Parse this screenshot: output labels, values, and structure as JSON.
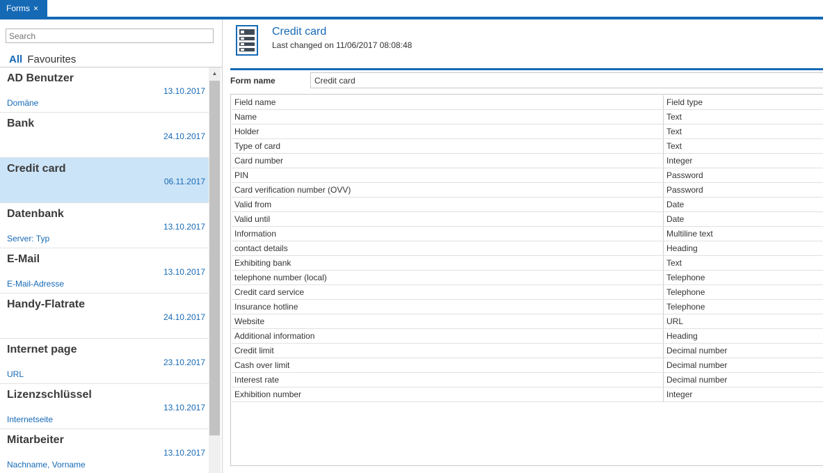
{
  "tab": {
    "label": "Forms",
    "close": "×"
  },
  "search": {
    "placeholder": "Search"
  },
  "filters": {
    "all": "All",
    "favourites": "Favourites"
  },
  "list": [
    {
      "title": "AD Benutzer",
      "date": "13.10.2017",
      "sub": "Domäne",
      "selected": false
    },
    {
      "title": "Bank",
      "date": "24.10.2017",
      "sub": "",
      "selected": false
    },
    {
      "title": "Credit card",
      "date": "06.11.2017",
      "sub": "",
      "selected": true
    },
    {
      "title": "Datenbank",
      "date": "13.10.2017",
      "sub": "Server: Typ",
      "selected": false
    },
    {
      "title": "E-Mail",
      "date": "13.10.2017",
      "sub": "E-Mail-Adresse",
      "selected": false
    },
    {
      "title": "Handy-Flatrate",
      "date": "24.10.2017",
      "sub": "",
      "selected": false
    },
    {
      "title": "Internet page",
      "date": "23.10.2017",
      "sub": "URL",
      "selected": false
    },
    {
      "title": "Lizenzschlüssel",
      "date": "13.10.2017",
      "sub": "Internetseite",
      "selected": false
    },
    {
      "title": "Mitarbeiter",
      "date": "13.10.2017",
      "sub": "Nachname, Vorname",
      "selected": false
    }
  ],
  "scrollbar": {
    "up_arrow": "▲"
  },
  "detail": {
    "title": "Credit card",
    "last_changed": "Last changed on 11/06/2017 08:08:48",
    "form_name_label": "Form name",
    "form_name_value": "Credit card",
    "columns": [
      "Field name",
      "Field type"
    ],
    "rows": [
      [
        "Name",
        "Text"
      ],
      [
        "Holder",
        "Text"
      ],
      [
        "Type of card",
        "Text"
      ],
      [
        "Card number",
        "Integer"
      ],
      [
        "PIN",
        "Password"
      ],
      [
        "Card verification number (OVV)",
        "Password"
      ],
      [
        "Valid from",
        "Date"
      ],
      [
        "Valid until",
        "Date"
      ],
      [
        "Information",
        "Multiline text"
      ],
      [
        "contact details",
        "Heading"
      ],
      [
        "Exhibiting bank",
        "Text"
      ],
      [
        "telephone number (local)",
        "Telephone"
      ],
      [
        "Credit card service",
        "Telephone"
      ],
      [
        "Insurance hotline",
        "Telephone"
      ],
      [
        "Website",
        "URL"
      ],
      [
        "Additional information",
        "Heading"
      ],
      [
        "Credit limit",
        "Decimal number"
      ],
      [
        "Cash over limit",
        "Decimal number"
      ],
      [
        "Interest rate",
        "Decimal number"
      ],
      [
        "Exhibition number",
        "Integer"
      ]
    ]
  },
  "colors": {
    "accent": "#1569b5",
    "selected_bg": "#cce4f7"
  }
}
